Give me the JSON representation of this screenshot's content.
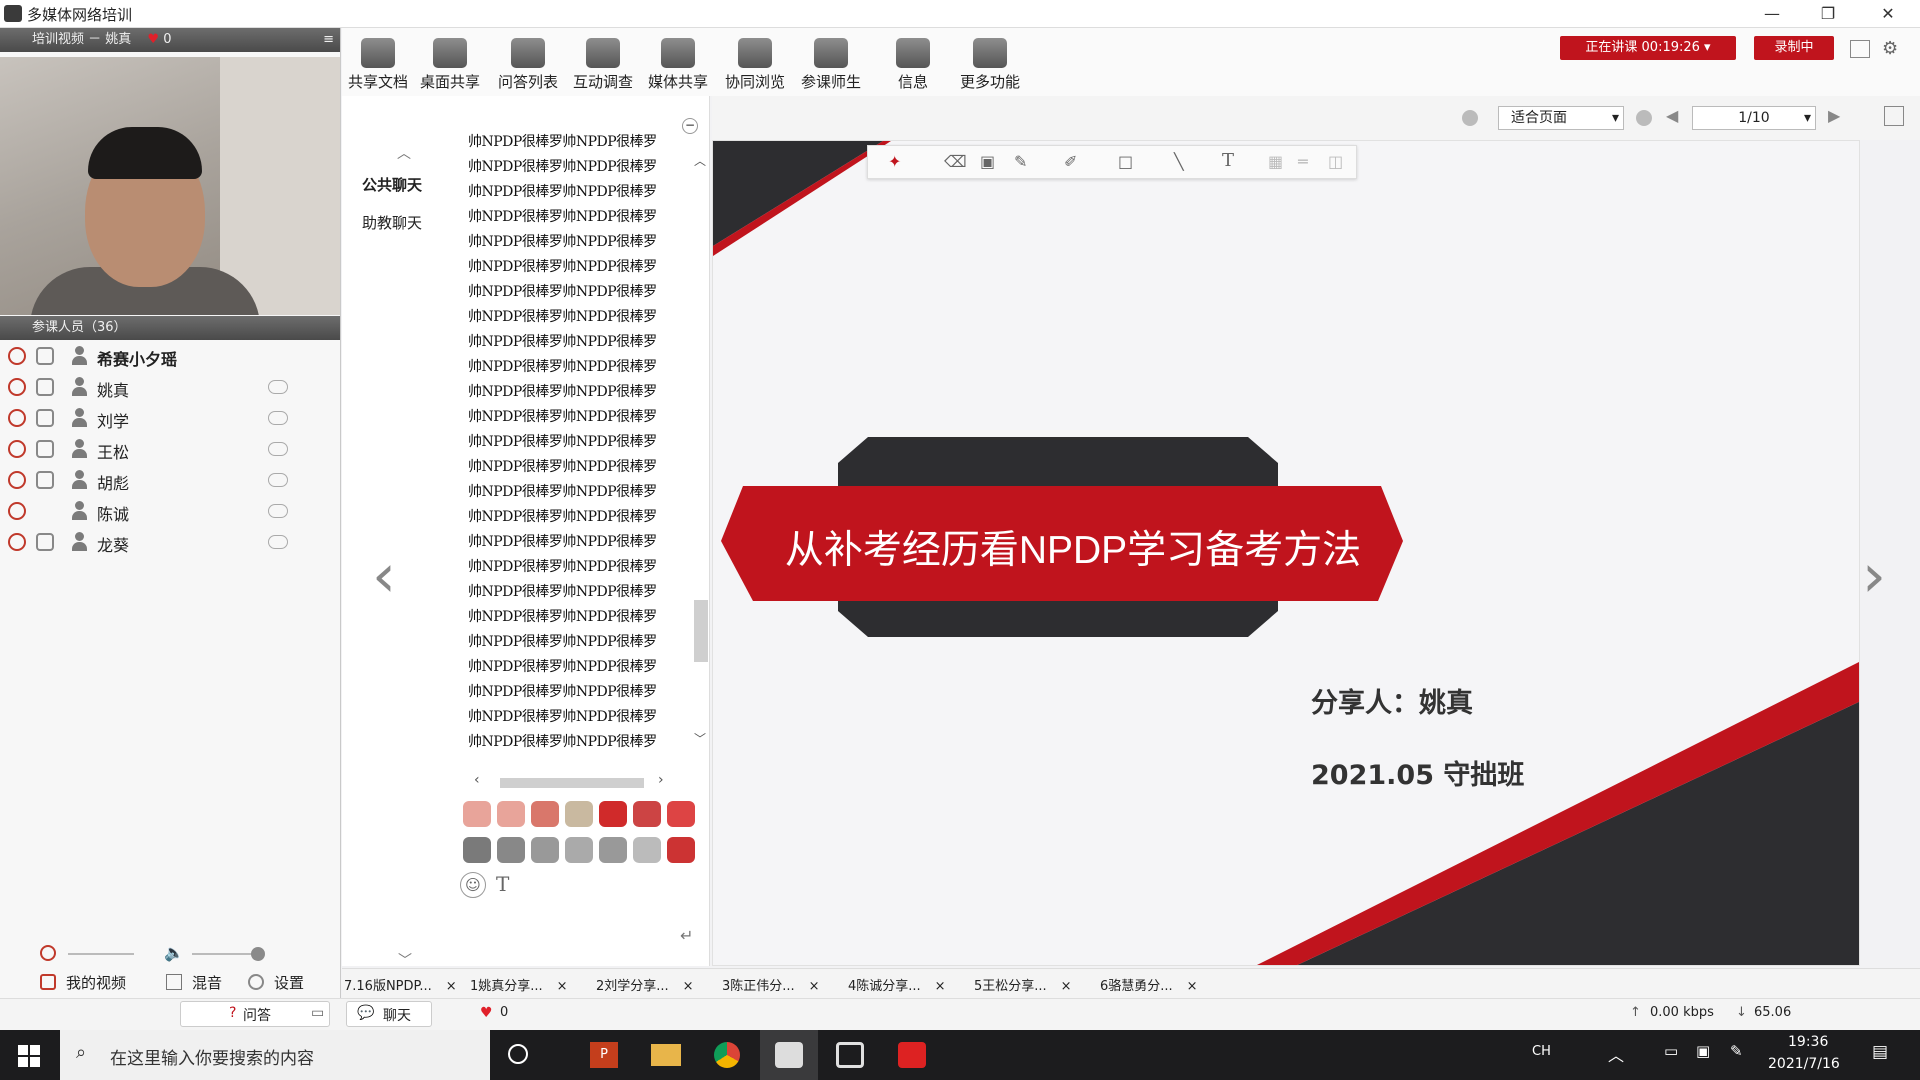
{
  "window": {
    "title": "多媒体网络培训",
    "min": "—",
    "max": "❐",
    "close": "✕"
  },
  "video_bar": {
    "label": "培训视频 － 姚真",
    "hearts": "0"
  },
  "members_bar": {
    "label": "参课人员（36）"
  },
  "members": [
    {
      "name": "希赛小夕瑶",
      "bold": true
    },
    {
      "name": "姚真",
      "bold": false
    },
    {
      "name": "刘学",
      "bold": false
    },
    {
      "name": "王松",
      "bold": false
    },
    {
      "name": "胡彪",
      "bold": false
    },
    {
      "name": "陈诚",
      "bold": false
    },
    {
      "name": "龙葵",
      "bold": false
    }
  ],
  "left_buttons": {
    "my_video": "我的视频",
    "mix": "混音",
    "settings": "设置"
  },
  "toolbar": [
    {
      "label": "共享文档"
    },
    {
      "label": "桌面共享"
    },
    {
      "label": "问答列表"
    },
    {
      "label": "互动调查"
    },
    {
      "label": "媒体共享"
    },
    {
      "label": "协同浏览"
    },
    {
      "label": "参课师生"
    },
    {
      "label": "信息"
    },
    {
      "label": "更多功能"
    }
  ],
  "session": {
    "status": "正在讲课 00:19:26",
    "record": "录制中"
  },
  "chat": {
    "tabs": [
      "公共聊天",
      "助教聊天"
    ],
    "message": "帅NPDP很棒罗帅NPDP很棒罗",
    "chat_label": "聊天",
    "hearts": "0",
    "qa_label": "问答"
  },
  "viewer": {
    "fit": "适合页面",
    "page": "1/10"
  },
  "slide": {
    "title": "从补考经历看NPDP学习备考方法",
    "presenter": "分享人：姚真",
    "cohort": "2021.05 守拙班"
  },
  "doc_tabs": [
    "7.16版NPDP...",
    "1姚真分享...",
    "2刘学分享...",
    "3陈正伟分...",
    "4陈诚分享...",
    "5王松分享...",
    "6骆慧勇分..."
  ],
  "status": {
    "upload": "0.00 kbps",
    "download": "65.06"
  },
  "taskbar": {
    "search_placeholder": "在这里输入你要搜索的内容",
    "time": "19:36",
    "date": "2021/7/16",
    "ime": "CH"
  },
  "colors": {
    "accent_red": "#c0141d",
    "dark_slide": "#2d2d30",
    "taskbar": "#1c1c1e"
  }
}
